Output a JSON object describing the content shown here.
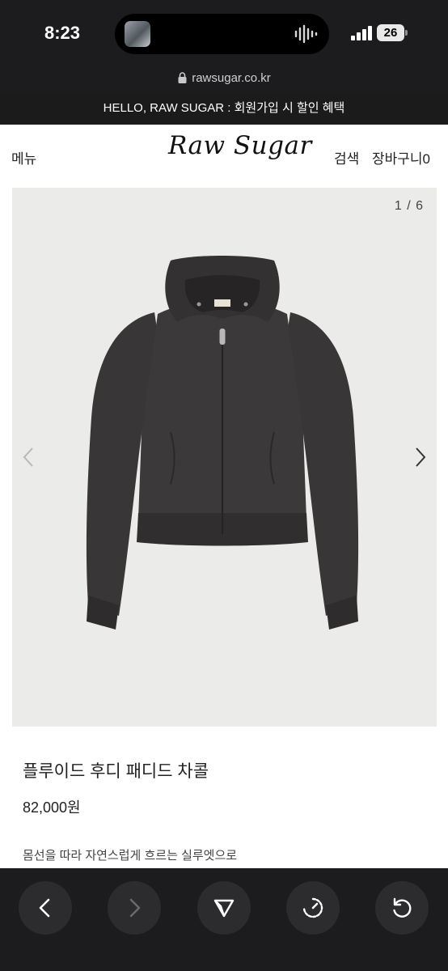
{
  "status_bar": {
    "time": "8:23",
    "battery": "26"
  },
  "browser": {
    "url": "rawsugar.co.kr"
  },
  "promo": {
    "text": "HELLO, RAW SUGAR : 회원가입 시 할인 혜택"
  },
  "header": {
    "menu_label": "메뉴",
    "logo_text": "Raw Sugar",
    "search_label": "검색",
    "cart_label": "장바구니0"
  },
  "gallery": {
    "counter": "1 / 6"
  },
  "product": {
    "name": "플루이드 후디 패디드 차콜",
    "price": "82,000원",
    "description": "몸선을 따라 자연스럽게 흐르는 실루엣으로"
  },
  "toolbar": {
    "buttons": [
      "back-icon",
      "forward-icon",
      "share-icon",
      "speed-icon",
      "reload-icon"
    ]
  },
  "colors": {
    "banner_bg": "#1b1b1b",
    "gallery_bg": "#ebebea",
    "hoodie": "#3a3838",
    "toolbar_bg": "#1c1c1e"
  }
}
